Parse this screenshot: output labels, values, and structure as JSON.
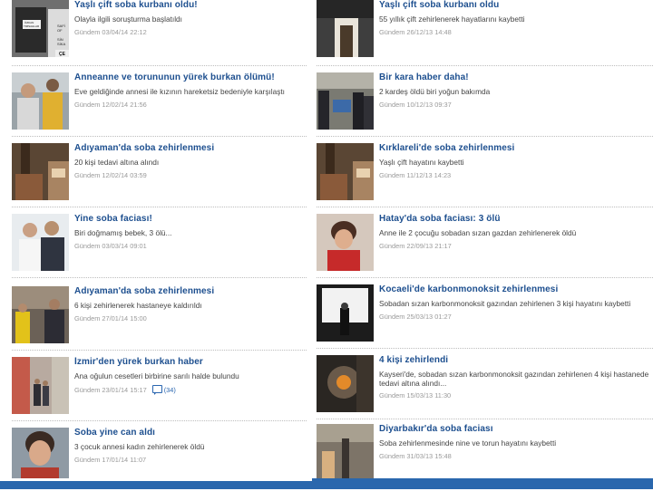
{
  "left_column": [
    {
      "title": "Yaşlı çift soba kurbanı oldu!",
      "summary": "Olayla ilgili soruşturma başlatıldı",
      "date": "Gündem 03/04/14 22:12",
      "thumb_text": [
        "ÖZKAN",
        "TIMSAHLAR",
        "SAFİ",
        "OF",
        "SİN",
        "SİKA",
        "ÇE"
      ]
    },
    {
      "title": "Anneanne ve torununun yürek burkan ölümü!",
      "summary": "Eve geldiğinde annesi ile kızının hareketsiz bedeniyle karşılaştı",
      "date": "Gündem 12/02/14 21:56"
    },
    {
      "title": "Adıyaman'da soba zehirlenmesi",
      "summary": "20 kişi tedavi altına alındı",
      "date": "Gündem 12/02/14 03:59"
    },
    {
      "title": "Yine soba faciası!",
      "summary": "Biri doğmamış bebek, 3 ölü...",
      "date": "Gündem 03/03/14 09:01"
    },
    {
      "title": "Adıyaman'da soba zehirlenmesi",
      "summary": "6 kişi zehirlenerek hastaneye kaldırıldı",
      "date": "Gündem 27/01/14 15:00"
    },
    {
      "title": "İzmir'den yürek burkan haber",
      "summary": "Ana oğulun cesetleri birbirine sarılı halde bulundu",
      "date": "Gündem 23/01/14 15:17",
      "comments": "(34)"
    },
    {
      "title": "Soba yine can aldı",
      "summary": "3 çocuk annesi kadın zehirlenerek öldü",
      "date": "Gündem 17/01/14 11:07"
    }
  ],
  "right_column": [
    {
      "title": "Yaşlı çift soba kurbanı oldu",
      "summary": "55 yıllık çift zehirlenerek hayatlarını kaybetti",
      "date": "Gündem 26/12/13 14:48"
    },
    {
      "title": "Bir kara haber daha!",
      "summary": "2 kardeş öldü biri yoğun bakımda",
      "date": "Gündem 10/12/13 09:37"
    },
    {
      "title": "Kırklareli'de soba zehirlenmesi",
      "summary": "Yaşlı çift hayatını kaybetti",
      "date": "Gündem 11/12/13 14:23"
    },
    {
      "title": "Hatay'da soba faciası: 3 ölü",
      "summary": "Anne ile 2 çocuğu sobadan sızan gazdan zehirlenerek öldü",
      "date": "Gündem 22/09/13 21:17"
    },
    {
      "title": "Kocaeli'de karbonmonoksit zehirlenmesi",
      "summary": "Sobadan sızan karbonmonoksit gazından zehirlenen 3 kişi hayatını kaybetti",
      "date": "Gündem 25/03/13 01:27"
    },
    {
      "title": "4 kişi zehirlendi",
      "summary": "Kayseri'de, sobadan sızan karbonmonoksit gazından zehirlenen 4 kişi hastanede tedavi altına alındı...",
      "date": "Gündem 15/03/13 11:30"
    },
    {
      "title": "Diyarbakır'da soba faciası",
      "summary": "Soba zehirlenmesinde nine ve torun hayatını kaybetti",
      "date": "Gündem 31/03/13 15:48"
    }
  ],
  "colors": {
    "title": "#1d4f8f",
    "summary": "#444444",
    "meta": "#999999",
    "bottom_bar": "#2a67ad"
  }
}
